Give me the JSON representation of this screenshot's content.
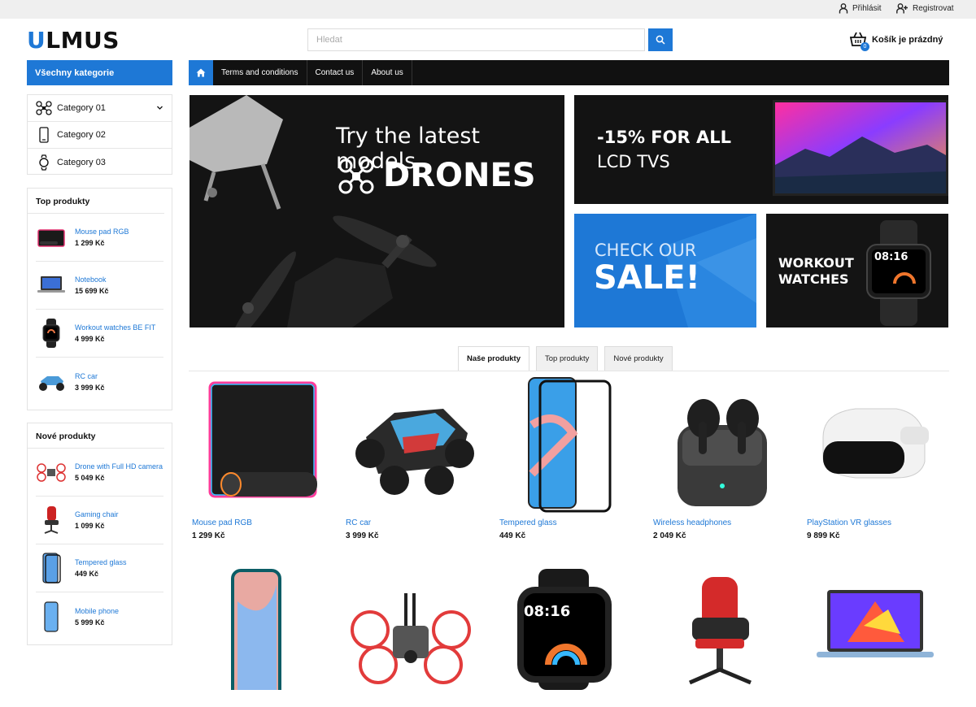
{
  "topbar": {
    "login": "Přihlásit",
    "register": "Registrovat"
  },
  "logo": {
    "first_letter": "U",
    "rest": "LMUS"
  },
  "search": {
    "placeholder": "Hledat"
  },
  "cart": {
    "label": "Košík je prázdný",
    "count": "0"
  },
  "all_categories": "Všechny kategorie",
  "nav": {
    "items": [
      "Terms and conditions",
      "Contact us",
      "About us"
    ]
  },
  "categories": [
    {
      "label": "Category 01",
      "icon": "drone-icon"
    },
    {
      "label": "Category 02",
      "icon": "phone-icon"
    },
    {
      "label": "Category 03",
      "icon": "watch-icon"
    }
  ],
  "top_products": {
    "title": "Top produkty",
    "items": [
      {
        "name": "Mouse pad RGB",
        "price": "1 299 Kč"
      },
      {
        "name": "Notebook",
        "price": "15 699 Kč"
      },
      {
        "name": "Workout watches BE FIT",
        "price": "4 999 Kč"
      },
      {
        "name": "RC car",
        "price": "3 999 Kč"
      }
    ]
  },
  "new_products": {
    "title": "Nové produkty",
    "items": [
      {
        "name": "Drone with Full HD camera",
        "price": "5 049 Kč"
      },
      {
        "name": "Gaming chair",
        "price": "1 099 Kč"
      },
      {
        "name": "Tempered glass",
        "price": "449 Kč"
      },
      {
        "name": "Mobile phone",
        "price": "5 999 Kč"
      }
    ]
  },
  "banners": {
    "drones": {
      "line1": "Try the latest models",
      "line2": "DRONES"
    },
    "tvs": {
      "line1": "-15% FOR ALL",
      "line2": "LCD TVS"
    },
    "sale": {
      "line1": "CHECK OUR",
      "line2": "SALE!"
    },
    "watches": {
      "line1": "WORKOUT",
      "line2": "WATCHES",
      "watch_time": "08:16"
    }
  },
  "tabs": [
    "Naše produkty",
    "Top produkty",
    "Nové produkty"
  ],
  "products": [
    {
      "name": "Mouse pad RGB",
      "price": "1 299 Kč"
    },
    {
      "name": "RC car",
      "price": "3 999 Kč"
    },
    {
      "name": "Tempered glass",
      "price": "449 Kč"
    },
    {
      "name": "Wireless headphones",
      "price": "2 049 Kč"
    },
    {
      "name": "PlayStation VR glasses",
      "price": "9 899 Kč"
    }
  ],
  "second_row_watch_time": "08:16",
  "colors": {
    "accent": "#1e78d6",
    "nav_bg": "#111111"
  }
}
